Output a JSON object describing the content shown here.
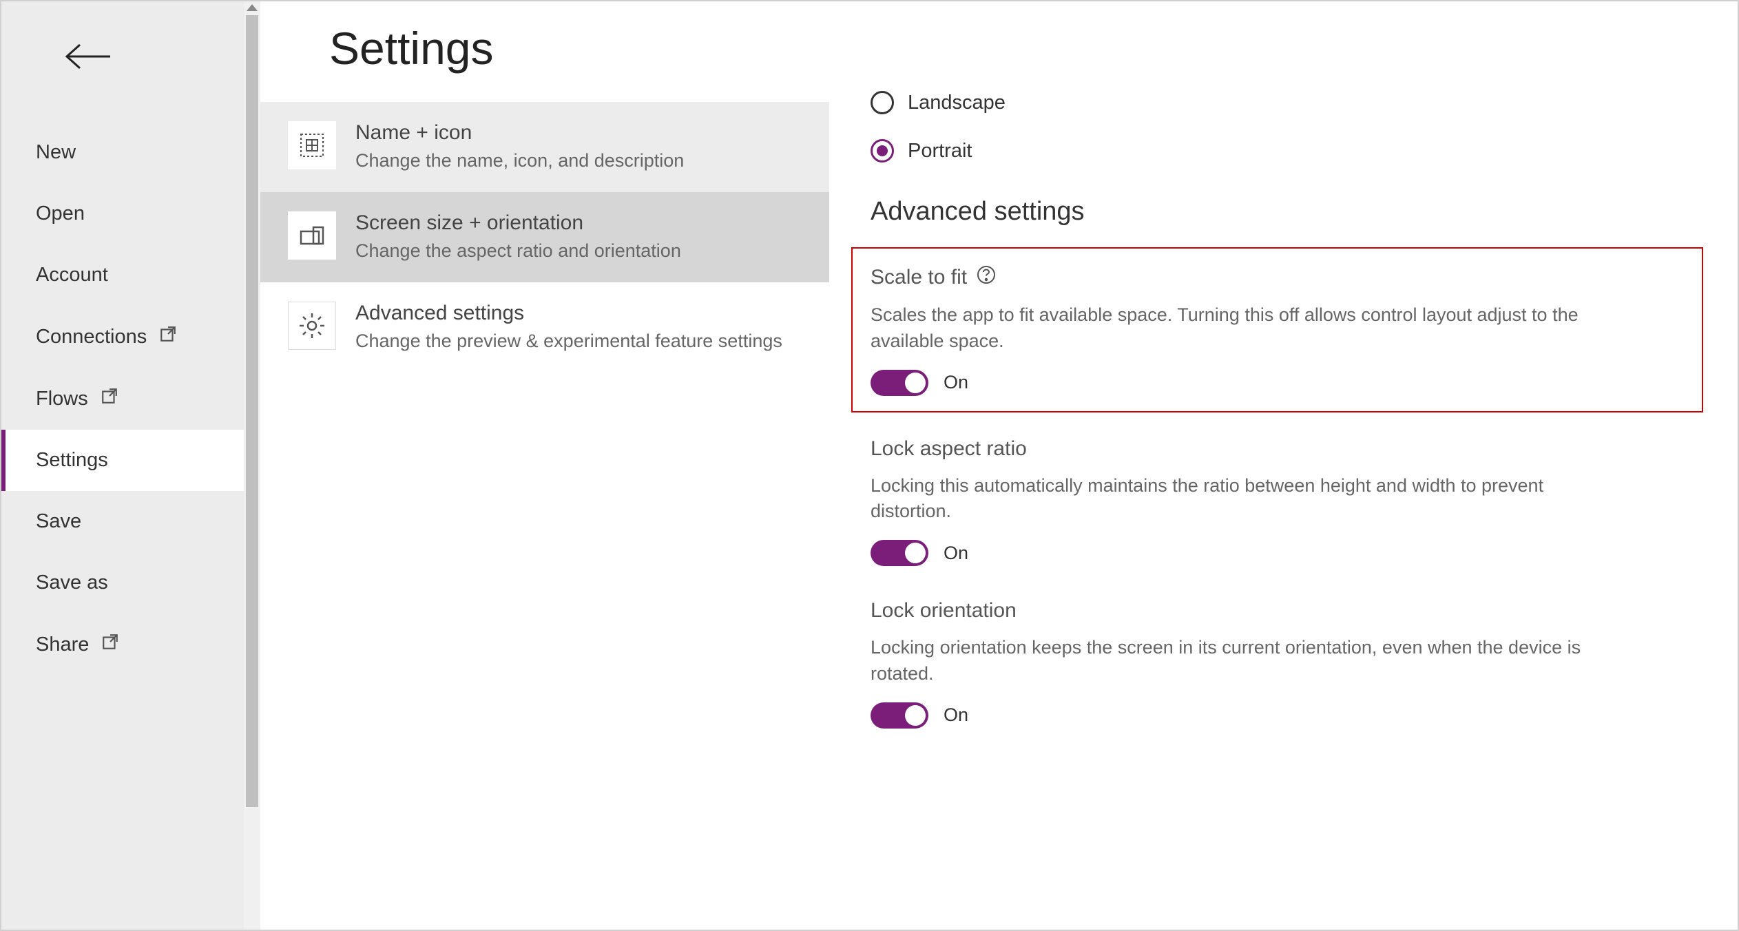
{
  "sidebar": {
    "items": [
      {
        "label": "New"
      },
      {
        "label": "Open"
      },
      {
        "label": "Account"
      },
      {
        "label": "Connections",
        "external": true
      },
      {
        "label": "Flows",
        "external": true
      },
      {
        "label": "Settings",
        "active": true
      },
      {
        "label": "Save"
      },
      {
        "label": "Save as"
      },
      {
        "label": "Share",
        "external": true
      }
    ]
  },
  "page": {
    "title": "Settings"
  },
  "settingsList": [
    {
      "title": "Name + icon",
      "desc": "Change the name, icon, and description"
    },
    {
      "title": "Screen size + orientation",
      "desc": "Change the aspect ratio and orientation"
    },
    {
      "title": "Advanced settings",
      "desc": "Change the preview & experimental feature settings"
    }
  ],
  "orientation": {
    "landscape": "Landscape",
    "portrait": "Portrait",
    "selected": "portrait"
  },
  "advanced": {
    "heading": "Advanced settings",
    "scaleToFit": {
      "title": "Scale to fit",
      "desc": "Scales the app to fit available space. Turning this off allows control layout adjust to the available space.",
      "state": "On"
    },
    "lockAspect": {
      "title": "Lock aspect ratio",
      "desc": "Locking this automatically maintains the ratio between height and width to prevent distortion.",
      "state": "On"
    },
    "lockOrientation": {
      "title": "Lock orientation",
      "desc": "Locking orientation keeps the screen in its current orientation, even when the device is rotated.",
      "state": "On"
    }
  }
}
